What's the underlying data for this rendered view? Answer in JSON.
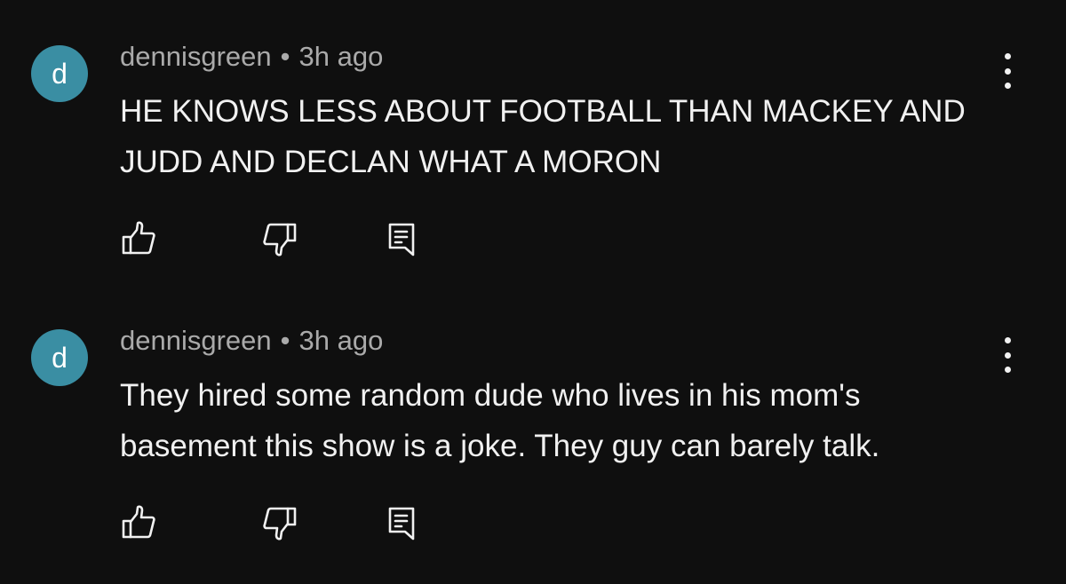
{
  "comments": [
    {
      "avatar_letter": "d",
      "author": "dennisgreen",
      "separator": "•",
      "time": "3h ago",
      "text": "HE KNOWS LESS ABOUT FOOTBALL THAN MACKEY AND JUDD AND DECLAN WHAT A MORON",
      "icons": {
        "more": "more-vertical-icon",
        "like": "thumbs-up-icon",
        "dislike": "thumbs-down-icon",
        "reply": "reply-comment-icon"
      }
    },
    {
      "avatar_letter": "d",
      "author": "dennisgreen",
      "separator": "•",
      "time": "3h ago",
      "text": "They hired some random dude who lives in his mom's basement this show is a joke. They guy can barely talk.",
      "icons": {
        "more": "more-vertical-icon",
        "like": "thumbs-up-icon",
        "dislike": "thumbs-down-icon",
        "reply": "reply-comment-icon"
      }
    }
  ],
  "colors": {
    "background": "#0f0f0f",
    "avatar": "#3a8ea3",
    "meta_text": "#aaaaaa",
    "body_text": "#f1f1f1"
  }
}
